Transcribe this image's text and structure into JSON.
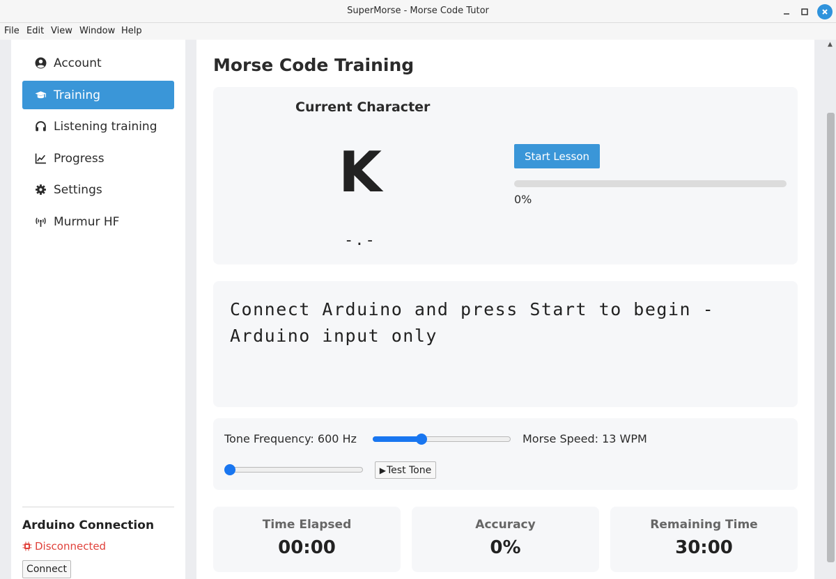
{
  "window": {
    "title": "SuperMorse - Morse Code Tutor"
  },
  "menubar": {
    "file": "File",
    "edit": "Edit",
    "view": "View",
    "window": "Window",
    "help": "Help"
  },
  "sidebar": {
    "items": [
      {
        "label": "Account",
        "icon": "user-circle-icon"
      },
      {
        "label": "Training",
        "icon": "graduation-cap-icon",
        "active": true
      },
      {
        "label": "Listening training",
        "icon": "headphones-icon"
      },
      {
        "label": "Progress",
        "icon": "chart-line-icon"
      },
      {
        "label": "Settings",
        "icon": "gear-icon"
      },
      {
        "label": "Murmur HF",
        "icon": "antenna-icon"
      }
    ],
    "arduino_title": "Arduino Connection",
    "status": "Disconnected",
    "connect_label": "Connect"
  },
  "main": {
    "title": "Morse Code Training",
    "current_label": "Current Character",
    "current_char": "K",
    "current_morse": "-.-",
    "start_label": "Start Lesson",
    "progress": 0,
    "progress_text": "0%",
    "message": "Connect Arduino and press Start to begin - Arduino input only",
    "tone_label": "Tone Frequency: 600 Hz",
    "tone_slider_fraction": 0.34,
    "speed_label": "Morse Speed: 13 WPM",
    "speed_slider_fraction": 0.0,
    "test_tone_label": "Test Tone",
    "stats": [
      {
        "label": "Time Elapsed",
        "value": "00:00"
      },
      {
        "label": "Accuracy",
        "value": "0%"
      },
      {
        "label": "Remaining Time",
        "value": "30:00"
      }
    ]
  },
  "colors": {
    "accent": "#3a96d8",
    "error": "#e0413a",
    "slider": "#1976f0"
  }
}
